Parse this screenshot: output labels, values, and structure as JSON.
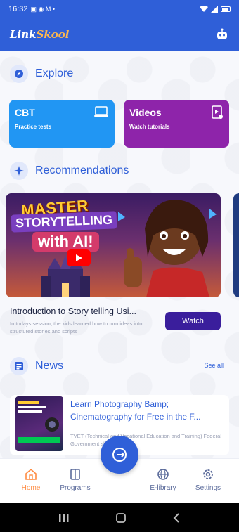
{
  "status_bar": {
    "time": "16:32",
    "left_icons": "▣ ◉ M •",
    "right_icons": "◇ ⊿"
  },
  "app_bar": {
    "logo_part1": "Link",
    "logo_part2": "Skool",
    "bot_icon": "robot-icon"
  },
  "explore": {
    "title": "Explore",
    "cards": [
      {
        "title": "CBT",
        "subtitle": "Practice tests",
        "color": "#2196f3",
        "icon": "laptop-icon"
      },
      {
        "title": "Videos",
        "subtitle": "Watch tutorials",
        "color": "#8e24aa",
        "icon": "video-file-icon"
      }
    ]
  },
  "recommendations": {
    "title": "Recommendations",
    "thumbnail_text": [
      "MASTER",
      "STORYTELLING",
      "with AI!"
    ],
    "video_title": "Introduction to Story telling Usi...",
    "video_description": "In todays session, the kids learned how to turn ideas into structured stories and scripts",
    "watch_label": "Watch"
  },
  "news": {
    "title": "News",
    "see_all": "See all",
    "items": [
      {
        "title": "Learn Photography Bamp; Cinematography for Free in the F...",
        "description": "TVET (Technical and Vocational Education and Training) Federal Government skills..."
      }
    ]
  },
  "bottom_nav": {
    "items": [
      "Home",
      "Programs",
      "E-library",
      "Settings"
    ],
    "active": "Home",
    "accent": "#ff8c42"
  },
  "colors": {
    "primary": "#2f5fd8",
    "watch_button": "#3a1e9c"
  }
}
